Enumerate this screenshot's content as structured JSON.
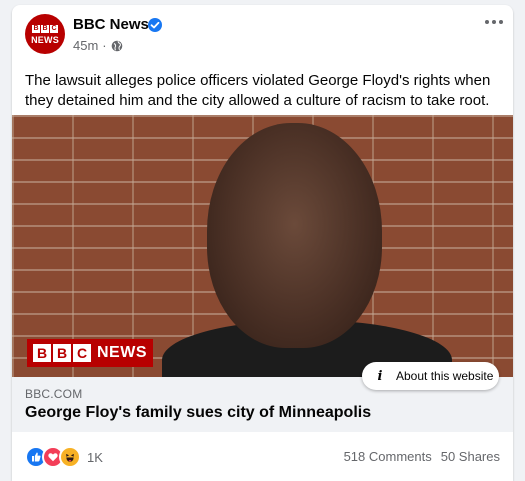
{
  "post": {
    "page_name": "BBC News",
    "avatar_blocks": [
      "B",
      "B",
      "C"
    ],
    "avatar_word": "NEWS",
    "time": "45m",
    "separator": "·",
    "caption": "The lawsuit alleges police officers violated George Floyd's rights when they detained him and the city allowed a culture of racism to take root."
  },
  "image_overlay": {
    "logo_blocks": [
      "B",
      "B",
      "C"
    ],
    "logo_word": "NEWS",
    "about_label": "About this website",
    "about_icon": "info-icon"
  },
  "link": {
    "domain": "BBC.COM",
    "title": "George Floy's family sues city of Minneapolis"
  },
  "footer": {
    "reactions": [
      "like-icon",
      "love-icon",
      "haha-icon"
    ],
    "reaction_count": "1K",
    "comments": "518 Comments",
    "shares": "50 Shares"
  },
  "colors": {
    "bbc_red": "#b80000",
    "verified_blue": "#1877f2",
    "muted_text": "#65676b"
  }
}
